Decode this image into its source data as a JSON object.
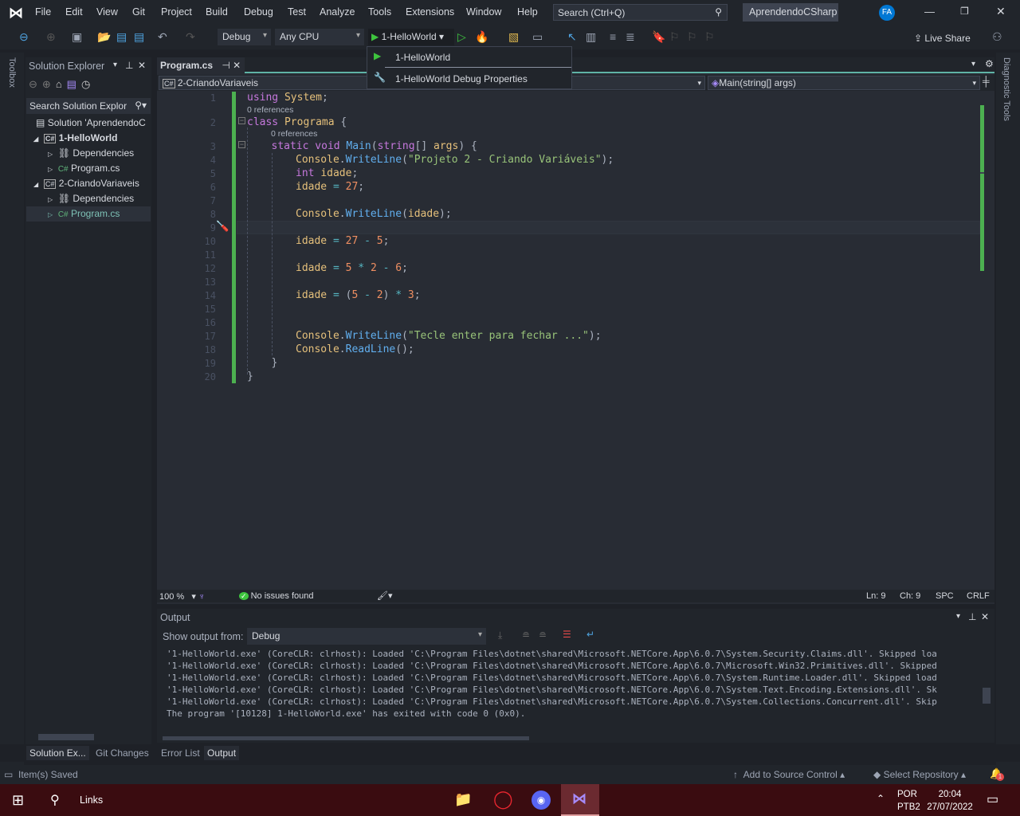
{
  "menu": [
    "File",
    "Edit",
    "View",
    "Git",
    "Project",
    "Build",
    "Debug",
    "Test",
    "Analyze",
    "Tools",
    "Extensions",
    "Window",
    "Help"
  ],
  "search_placeholder": "Search (Ctrl+Q)",
  "project_name": "AprendendoCSharp",
  "user_initials": "FA",
  "toolbar": {
    "config": "Debug",
    "platform": "Any CPU",
    "startup": "1-HelloWorld",
    "live_share": "Live Share"
  },
  "dropdown": {
    "items": [
      "1-HelloWorld",
      "1-HelloWorld Debug Properties"
    ]
  },
  "toolbox_label": "Toolbox",
  "diagnostic_label": "Diagnostic Tools",
  "solution_explorer": {
    "title": "Solution Explorer",
    "search_placeholder": "Search Solution Explor",
    "items": [
      {
        "label": "Solution 'AprendendoC",
        "icon": "solution-icon"
      },
      {
        "label": "1-HelloWorld",
        "icon": "csharp-project-icon",
        "bold": true
      },
      {
        "label": "Dependencies",
        "icon": "dependencies-icon"
      },
      {
        "label": "Program.cs",
        "icon": "csharp-file-icon"
      },
      {
        "label": "2-CriandoVariaveis",
        "icon": "csharp-project-icon"
      },
      {
        "label": "Dependencies",
        "icon": "dependencies-icon"
      },
      {
        "label": "Program.cs",
        "icon": "csharp-file-icon"
      }
    ]
  },
  "editor": {
    "tab": "Program.cs",
    "nav_project": "2-CriandoVariaveis",
    "nav_member": "Main(string[] args)",
    "references": "0 references",
    "lines": [
      {
        "n": "1",
        "i": 0,
        "tk": [
          [
            "using ",
            "k"
          ],
          [
            "System",
            "t"
          ],
          [
            ";",
            "p"
          ]
        ]
      },
      {
        "n": "2",
        "i": 0,
        "tk": [
          [
            "class ",
            "k"
          ],
          [
            "Programa ",
            "t"
          ],
          [
            "{",
            "p"
          ]
        ]
      },
      {
        "n": "3",
        "i": 1,
        "tk": [
          [
            "static void ",
            "k"
          ],
          [
            "Main",
            "m"
          ],
          [
            "(",
            "p"
          ],
          [
            "string",
            "k"
          ],
          [
            "[] ",
            "p"
          ],
          [
            "args",
            "v"
          ],
          [
            ") {",
            "p"
          ]
        ]
      },
      {
        "n": "4",
        "i": 2,
        "tk": [
          [
            "Console",
            "t"
          ],
          [
            ".",
            "p"
          ],
          [
            "WriteLine",
            "m"
          ],
          [
            "(",
            "p"
          ],
          [
            "\"Projeto 2 - Criando Variáveis\"",
            "s"
          ],
          [
            ");",
            "p"
          ]
        ]
      },
      {
        "n": "5",
        "i": 2,
        "tk": [
          [
            "int ",
            "k"
          ],
          [
            "idade",
            "v"
          ],
          [
            ";",
            "p"
          ]
        ]
      },
      {
        "n": "6",
        "i": 2,
        "tk": [
          [
            "idade ",
            "v"
          ],
          [
            "= ",
            "o"
          ],
          [
            "27",
            "n"
          ],
          [
            ";",
            "p"
          ]
        ]
      },
      {
        "n": "7",
        "i": 2,
        "tk": []
      },
      {
        "n": "8",
        "i": 2,
        "tk": [
          [
            "Console",
            "t"
          ],
          [
            ".",
            "p"
          ],
          [
            "WriteLine",
            "m"
          ],
          [
            "(",
            "p"
          ],
          [
            "idade",
            "v"
          ],
          [
            ");",
            "p"
          ]
        ]
      },
      {
        "n": "9",
        "i": 2,
        "tk": []
      },
      {
        "n": "10",
        "i": 2,
        "tk": [
          [
            "idade ",
            "v"
          ],
          [
            "= ",
            "o"
          ],
          [
            "27 ",
            "n"
          ],
          [
            "- ",
            "o"
          ],
          [
            "5",
            "n"
          ],
          [
            ";",
            "p"
          ]
        ]
      },
      {
        "n": "11",
        "i": 2,
        "tk": []
      },
      {
        "n": "12",
        "i": 2,
        "tk": [
          [
            "idade ",
            "v"
          ],
          [
            "= ",
            "o"
          ],
          [
            "5 ",
            "n"
          ],
          [
            "* ",
            "o"
          ],
          [
            "2 ",
            "n"
          ],
          [
            "- ",
            "o"
          ],
          [
            "6",
            "n"
          ],
          [
            ";",
            "p"
          ]
        ]
      },
      {
        "n": "13",
        "i": 2,
        "tk": []
      },
      {
        "n": "14",
        "i": 2,
        "tk": [
          [
            "idade ",
            "v"
          ],
          [
            "= ",
            "o"
          ],
          [
            "(",
            "p"
          ],
          [
            "5 ",
            "n"
          ],
          [
            "- ",
            "o"
          ],
          [
            "2",
            "n"
          ],
          [
            ") ",
            "p"
          ],
          [
            "* ",
            "o"
          ],
          [
            "3",
            "n"
          ],
          [
            ";",
            "p"
          ]
        ]
      },
      {
        "n": "15",
        "i": 2,
        "tk": []
      },
      {
        "n": "16",
        "i": 2,
        "tk": []
      },
      {
        "n": "17",
        "i": 2,
        "tk": [
          [
            "Console",
            "t"
          ],
          [
            ".",
            "p"
          ],
          [
            "WriteLine",
            "m"
          ],
          [
            "(",
            "p"
          ],
          [
            "\"Tecle enter para fechar ...\"",
            "s"
          ],
          [
            ");",
            "p"
          ]
        ]
      },
      {
        "n": "18",
        "i": 2,
        "tk": [
          [
            "Console",
            "t"
          ],
          [
            ".",
            "p"
          ],
          [
            "ReadLine",
            "m"
          ],
          [
            "();",
            "p"
          ]
        ]
      },
      {
        "n": "19",
        "i": 1,
        "tk": [
          [
            "}",
            "p"
          ]
        ]
      },
      {
        "n": "20",
        "i": 0,
        "tk": [
          [
            "}",
            "p"
          ]
        ]
      }
    ]
  },
  "editor_status": {
    "zoom": "100 %",
    "issues": "No issues found",
    "ln": "Ln: 9",
    "ch": "Ch: 9",
    "spc": "SPC",
    "crlf": "CRLF"
  },
  "output": {
    "title": "Output",
    "show_from_label": "Show output from:",
    "source": "Debug",
    "lines": [
      "'1-HelloWorld.exe' (CoreCLR: clrhost): Loaded 'C:\\Program Files\\dotnet\\shared\\Microsoft.NETCore.App\\6.0.7\\System.Security.Claims.dll'. Skipped loa",
      "'1-HelloWorld.exe' (CoreCLR: clrhost): Loaded 'C:\\Program Files\\dotnet\\shared\\Microsoft.NETCore.App\\6.0.7\\Microsoft.Win32.Primitives.dll'. Skipped",
      "'1-HelloWorld.exe' (CoreCLR: clrhost): Loaded 'C:\\Program Files\\dotnet\\shared\\Microsoft.NETCore.App\\6.0.7\\System.Runtime.Loader.dll'. Skipped load",
      "'1-HelloWorld.exe' (CoreCLR: clrhost): Loaded 'C:\\Program Files\\dotnet\\shared\\Microsoft.NETCore.App\\6.0.7\\System.Text.Encoding.Extensions.dll'. Sk",
      "'1-HelloWorld.exe' (CoreCLR: clrhost): Loaded 'C:\\Program Files\\dotnet\\shared\\Microsoft.NETCore.App\\6.0.7\\System.Collections.Concurrent.dll'. Skip",
      "The program '[10128] 1-HelloWorld.exe' has exited with code 0 (0x0)."
    ]
  },
  "bottom_tabs": {
    "left": [
      "Solution Ex...",
      "Git Changes"
    ],
    "right": [
      "Error List",
      "Output"
    ]
  },
  "statusbar": {
    "message": "Item(s) Saved",
    "source_control": "Add to Source Control",
    "repository": "Select Repository",
    "notifications": "1"
  },
  "taskbar": {
    "links": "Links",
    "lang": "POR",
    "layout": "PTB2",
    "time": "20:04",
    "date": "27/07/2022"
  }
}
